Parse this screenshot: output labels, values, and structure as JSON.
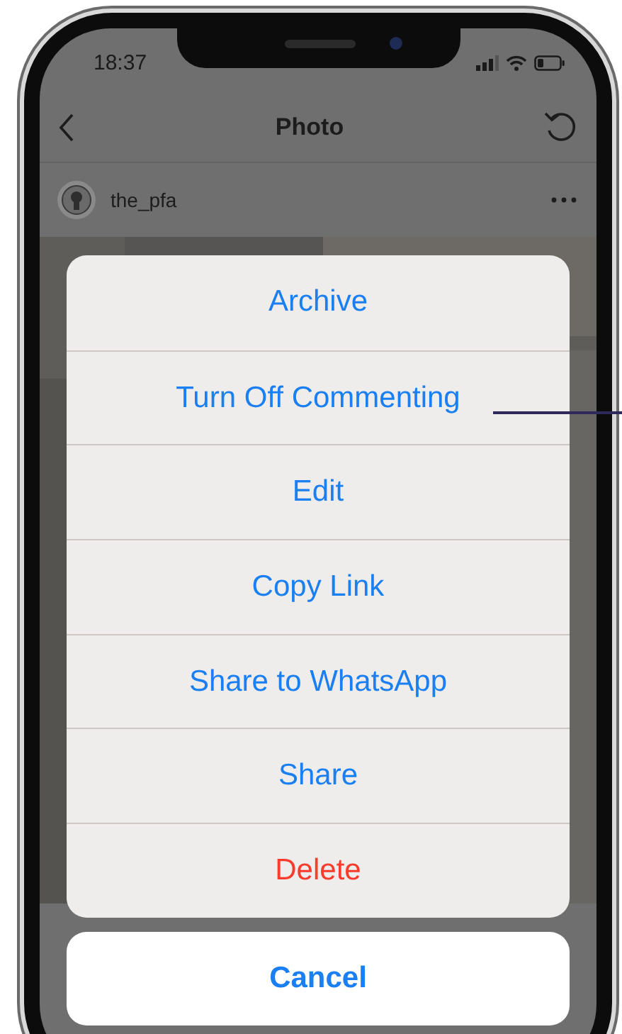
{
  "status_bar": {
    "time": "18:37"
  },
  "nav_bar": {
    "title": "Photo"
  },
  "post": {
    "username": "the_pfa"
  },
  "action_sheet": {
    "actions": [
      {
        "label": "Archive",
        "kind": "default"
      },
      {
        "label": "Turn Off Commenting",
        "kind": "default"
      },
      {
        "label": "Edit",
        "kind": "default"
      },
      {
        "label": "Copy Link",
        "kind": "default"
      },
      {
        "label": "Share to WhatsApp",
        "kind": "default"
      },
      {
        "label": "Share",
        "kind": "default"
      },
      {
        "label": "Delete",
        "kind": "destructive"
      }
    ],
    "cancel": {
      "label": "Cancel"
    }
  }
}
